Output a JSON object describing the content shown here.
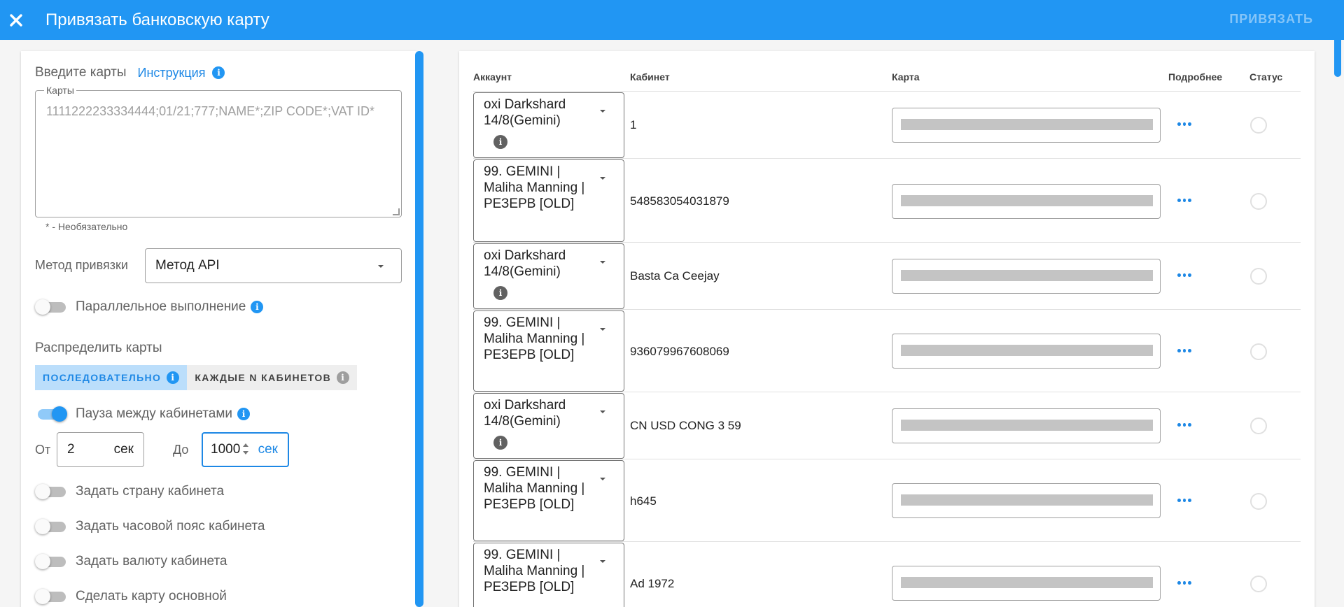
{
  "header": {
    "title": "Привязать банковскую карту",
    "action_label": "ПРИВЯЗАТЬ",
    "close_icon": "close-icon"
  },
  "left": {
    "heading": "Введите карты",
    "instruction_link": "Инструкция",
    "cards_legend": "Карты",
    "cards_placeholder": "1111222233334444;01/21;777;NAME*;ZIP CODE*;VAT ID*",
    "optional_hint": "* - Необязательно",
    "method_label": "Метод привязки",
    "method_value": "Метод API",
    "parallel_label": "Параллельное выполнение",
    "parallel_on": false,
    "distribute_label": "Распределить карты",
    "distribute_options": [
      "ПОСЛЕДОВАТЕЛЬНО",
      "КАЖДЫЕ N КАБИНЕТОВ"
    ],
    "distribute_selected": "ПОСЛЕДОВАТЕЛЬНО",
    "pause_label": "Пауза между кабинетами",
    "pause_on": true,
    "from_label": "От",
    "from_value": "2",
    "to_label": "До",
    "to_value": "1000",
    "unit": "сек",
    "country_label": "Задать страну кабинета",
    "timezone_label": "Задать часовой пояс кабинета",
    "currency_label": "Задать валюту кабинета",
    "primary_label": "Сделать карту основной"
  },
  "table": {
    "columns": [
      "Аккаунт",
      "Кабинет",
      "Карта",
      "Подробнее",
      "Статус"
    ],
    "rows": [
      {
        "account": "oxi Darkshard 14/8(Gemini)",
        "has_info": true,
        "cabinet": "1"
      },
      {
        "account": "99. GEMINI | Maliha Manning | РЕЗЕРВ [OLD]",
        "has_info": false,
        "cabinet": "548583054031879"
      },
      {
        "account": "oxi Darkshard 14/8(Gemini)",
        "has_info": true,
        "cabinet": "Basta Ca Ceejay"
      },
      {
        "account": "99. GEMINI | Maliha Manning | РЕЗЕРВ [OLD]",
        "has_info": false,
        "cabinet": "936079967608069"
      },
      {
        "account": "oxi Darkshard 14/8(Gemini)",
        "has_info": true,
        "cabinet": "CN USD CONG 3 59"
      },
      {
        "account": "99. GEMINI | Maliha Manning | РЕЗЕРВ [OLD]",
        "has_info": false,
        "cabinet": "h645"
      },
      {
        "account": "99. GEMINI | Maliha Manning | РЕЗЕРВ [OLD]",
        "has_info": false,
        "cabinet": "Ad 1972"
      }
    ]
  },
  "colors": {
    "primary": "#2196f3",
    "primary_dark": "#1e88e5",
    "text": "#212121",
    "muted": "#616161"
  }
}
